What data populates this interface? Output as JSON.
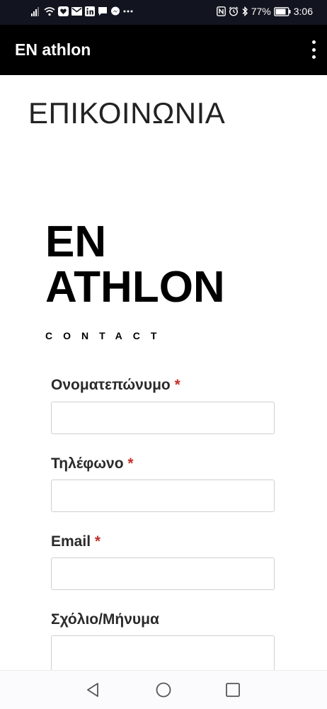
{
  "status": {
    "battery": "77%",
    "time": "3:06"
  },
  "app": {
    "title": "EN athlon"
  },
  "page": {
    "heading": "ΕΠΙΚΟΙΝΩΝΙΑ",
    "brand_line1": "EN",
    "brand_line2": "ATHLON",
    "subtitle": "CONTACT"
  },
  "form": {
    "required_mark": "*",
    "name_label": "Ονοματεπώνυμο",
    "phone_label": "Τηλέφωνο",
    "email_label": "Email",
    "message_label": "Σχόλιο/Μήνυμα"
  },
  "colors": {
    "statusbar": "#12151f",
    "appbar": "#000000",
    "required": "#c4302b"
  },
  "icons": {
    "status_left": [
      "signal-icon",
      "wifi-icon",
      "heart-app-icon",
      "mail-icon",
      "linkedin-icon",
      "chat-icon",
      "messenger-icon",
      "more-dots-icon"
    ],
    "status_right": [
      "nfc-icon",
      "alarm-icon",
      "bluetooth-icon",
      "battery-icon"
    ],
    "nav": [
      "back-icon",
      "home-icon",
      "recents-icon"
    ]
  }
}
